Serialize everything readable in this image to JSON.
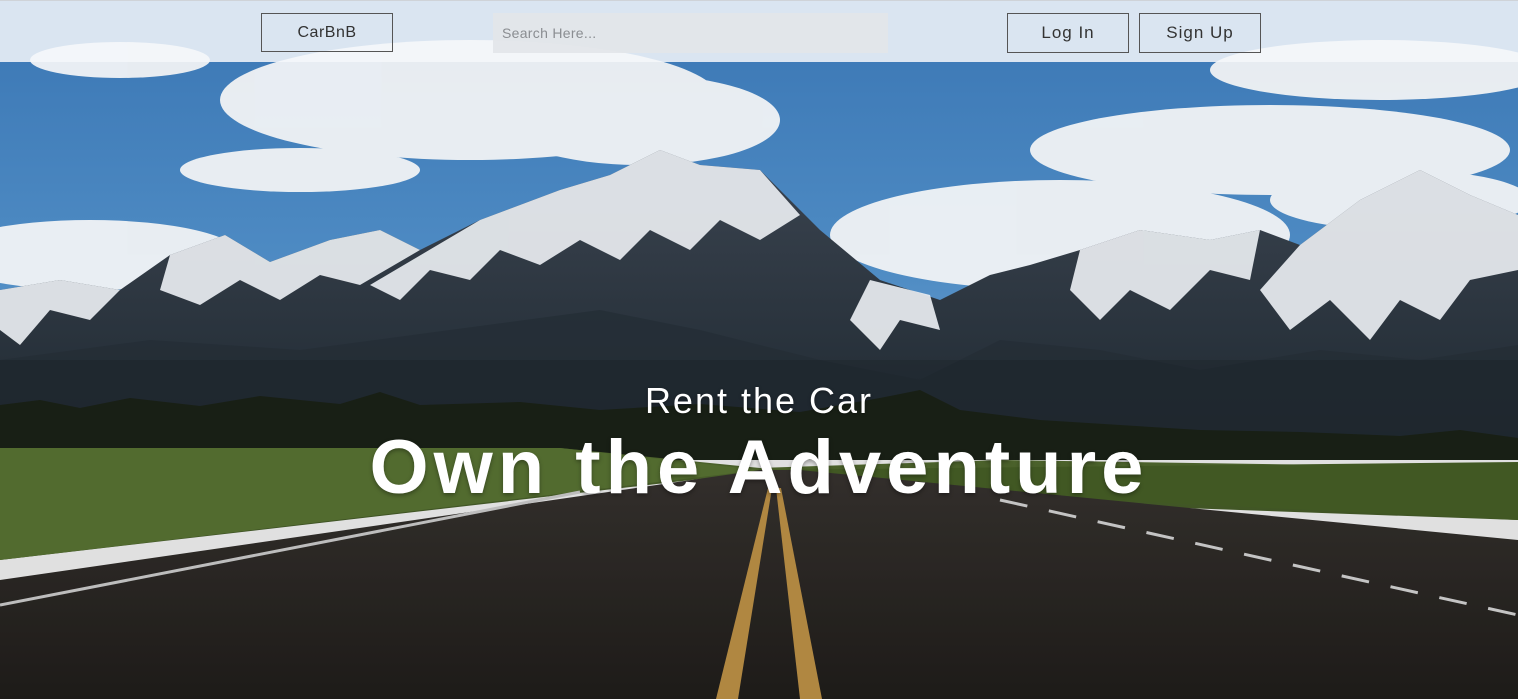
{
  "navbar": {
    "brand_label": "CarBnB",
    "search_placeholder": "Search Here...",
    "login_label": "Log In",
    "signup_label": "Sign Up"
  },
  "hero": {
    "subtitle": "Rent the Car",
    "title": "Own the Adventure",
    "background": "mountain-road-scene"
  },
  "colors": {
    "sky": "#3d7ab8",
    "cloud": "#f2f4f6",
    "snow": "#eef1f4",
    "rock": "#2e3640",
    "grass": "#4f6a2c",
    "road": "#2a2623",
    "center_line": "#c99a4a",
    "hero_text": "#ffffff"
  }
}
